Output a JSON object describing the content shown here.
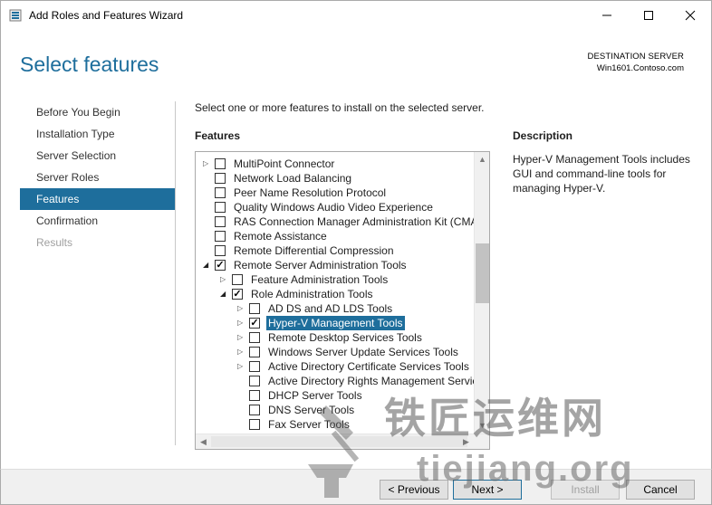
{
  "window": {
    "title": "Add Roles and Features Wizard",
    "icons": {
      "app": "server-manager-icon",
      "minimize": "minimize-icon",
      "maximize": "maximize-icon",
      "close": "close-icon"
    }
  },
  "header": {
    "page_title": "Select features",
    "destination_label": "DESTINATION SERVER",
    "destination_server": "Win1601.Contoso.com"
  },
  "nav": {
    "items": [
      {
        "label": "Before You Begin",
        "state": "normal"
      },
      {
        "label": "Installation Type",
        "state": "normal"
      },
      {
        "label": "Server Selection",
        "state": "normal"
      },
      {
        "label": "Server Roles",
        "state": "normal"
      },
      {
        "label": "Features",
        "state": "active"
      },
      {
        "label": "Confirmation",
        "state": "normal"
      },
      {
        "label": "Results",
        "state": "disabled"
      }
    ]
  },
  "main": {
    "instruction": "Select one or more features to install on the selected server.",
    "features_heading": "Features",
    "features": [
      {
        "label": "MultiPoint Connector",
        "checked": false,
        "arrow": "collapsed",
        "level": 0
      },
      {
        "label": "Network Load Balancing",
        "checked": false,
        "arrow": "none",
        "level": 0
      },
      {
        "label": "Peer Name Resolution Protocol",
        "checked": false,
        "arrow": "none",
        "level": 0
      },
      {
        "label": "Quality Windows Audio Video Experience",
        "checked": false,
        "arrow": "none",
        "level": 0
      },
      {
        "label": "RAS Connection Manager Administration Kit (CMA",
        "checked": false,
        "arrow": "none",
        "level": 0
      },
      {
        "label": "Remote Assistance",
        "checked": false,
        "arrow": "none",
        "level": 0
      },
      {
        "label": "Remote Differential Compression",
        "checked": false,
        "arrow": "none",
        "level": 0
      },
      {
        "label": "Remote Server Administration Tools",
        "checked": true,
        "arrow": "expanded",
        "level": 0
      },
      {
        "label": "Feature Administration Tools",
        "checked": false,
        "arrow": "collapsed",
        "level": 1
      },
      {
        "label": "Role Administration Tools",
        "checked": true,
        "arrow": "expanded",
        "level": 1
      },
      {
        "label": "AD DS and AD LDS Tools",
        "checked": false,
        "arrow": "collapsed",
        "level": 2
      },
      {
        "label": "Hyper-V Management Tools",
        "checked": true,
        "arrow": "collapsed",
        "level": 2,
        "selected": true
      },
      {
        "label": "Remote Desktop Services Tools",
        "checked": false,
        "arrow": "collapsed",
        "level": 2
      },
      {
        "label": "Windows Server Update Services Tools",
        "checked": false,
        "arrow": "collapsed",
        "level": 2
      },
      {
        "label": "Active Directory Certificate Services Tools",
        "checked": false,
        "arrow": "collapsed",
        "level": 2
      },
      {
        "label": "Active Directory Rights Management Servic",
        "checked": false,
        "arrow": "none",
        "level": 2
      },
      {
        "label": "DHCP Server Tools",
        "checked": false,
        "arrow": "none",
        "level": 2
      },
      {
        "label": "DNS Server Tools",
        "checked": false,
        "arrow": "none",
        "level": 2
      },
      {
        "label": "Fax Server Tools",
        "checked": false,
        "arrow": "none",
        "level": 2
      }
    ],
    "description_heading": "Description",
    "description": "Hyper-V Management Tools includes GUI and command-line tools for managing Hyper-V."
  },
  "footer": {
    "previous": "< Previous",
    "next": "Next >",
    "install": "Install",
    "cancel": "Cancel"
  },
  "watermark": {
    "line1": "铁匠运维网",
    "line2": "tiejiang.org",
    "logo_icon": "anvil-hammer-logo-icon"
  },
  "colors": {
    "accent": "#1e6e9c",
    "footer_bg": "#f0f0f0"
  }
}
